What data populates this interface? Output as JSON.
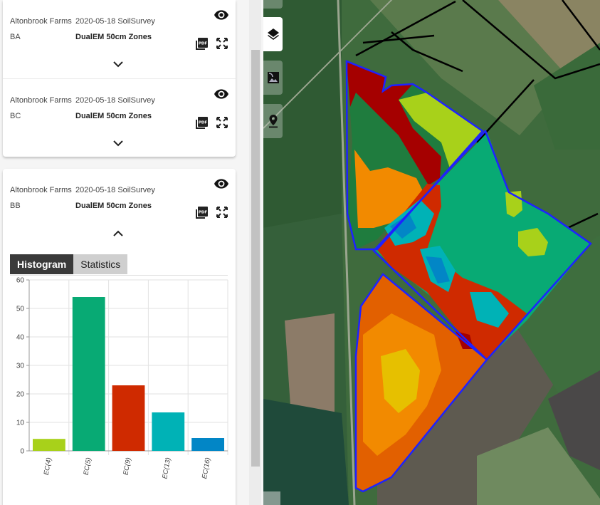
{
  "colors": {
    "ec4": "#a8d11a",
    "ec5": "#08aa74",
    "ec9": "#cf2a00",
    "ec13": "#00b2b6",
    "ec16": "#0286c6",
    "boundary": "#1e22ff",
    "tab_active": "#3a3a3a",
    "tab_inactive": "#cfcfcf"
  },
  "layers": [
    {
      "farm": "Altonbrook Farms",
      "survey": "2020-05-18 SoilSurvey",
      "field": "BA",
      "layer": "DualEM 50cm Zones",
      "expanded": false,
      "icons": [
        "eye-icon",
        "pdf-icon",
        "fullscreen-icon",
        "chevron-down-icon"
      ]
    },
    {
      "farm": "Altonbrook Farms",
      "survey": "2020-05-18 SoilSurvey",
      "field": "BC",
      "layer": "DualEM 50cm Zones",
      "expanded": false,
      "icons": [
        "eye-icon",
        "pdf-icon",
        "fullscreen-icon",
        "chevron-down-icon"
      ]
    },
    {
      "farm": "Altonbrook Farms",
      "survey": "2020-05-18 SoilSurvey",
      "field": "BB",
      "layer": "DualEM 50cm Zones",
      "expanded": true,
      "icons": [
        "eye-icon",
        "pdf-icon",
        "fullscreen-icon",
        "chevron-up-icon"
      ]
    }
  ],
  "tabs": {
    "histogram": "Histogram",
    "statistics": "Statistics",
    "active": "Histogram"
  },
  "map_controls": [
    "layers-icon",
    "image-icon",
    "map-marker-icon"
  ],
  "chart_data": {
    "type": "bar",
    "title": "",
    "xlabel": "",
    "ylabel": "",
    "categories": [
      "EC(4)",
      "EC(5)",
      "EC(9)",
      "EC(13)",
      "EC(16)"
    ],
    "values": [
      4.2,
      54,
      23,
      13.5,
      4.5
    ],
    "bar_colors": [
      "#a8d11a",
      "#08aa74",
      "#cf2a00",
      "#00b2b6",
      "#0286c6"
    ],
    "ylim": [
      0,
      60
    ],
    "yticks": [
      0,
      10,
      20,
      30,
      40,
      50,
      60
    ],
    "grid": true,
    "legend": "none"
  }
}
